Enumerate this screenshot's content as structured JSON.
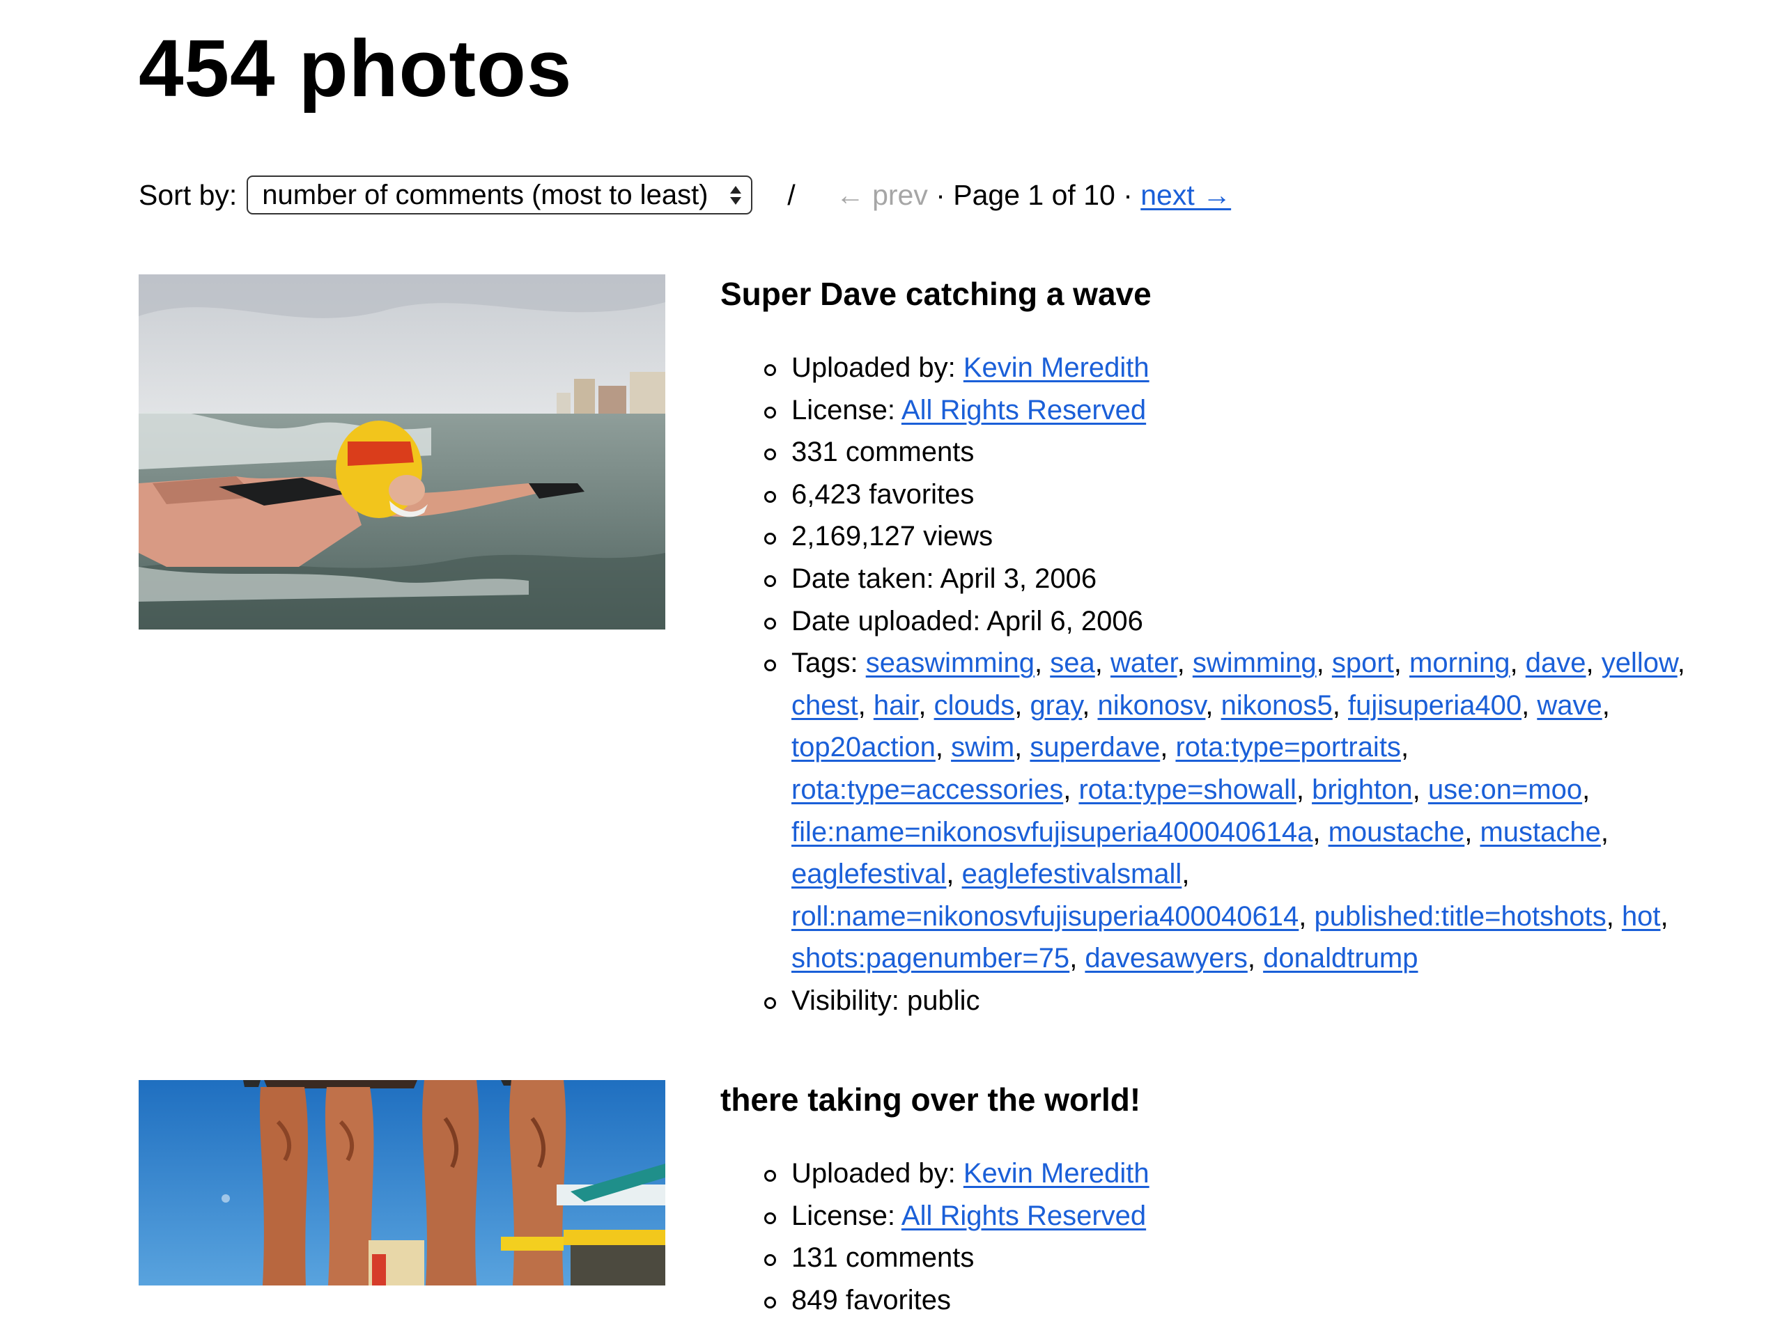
{
  "header": {
    "title": "454 photos"
  },
  "controls": {
    "sort_label": "Sort by:",
    "sort_selected": "number of comments (most to least)",
    "separator": "/",
    "prev_label": "← prev",
    "dot1": " · ",
    "page_label": "Page 1 of 10",
    "dot2": " · ",
    "next_label": "next →"
  },
  "colors": {
    "link": "#1a5fd8",
    "disabled": "#a6a6a6",
    "text": "#000000"
  },
  "photos": [
    {
      "title": "Super Dave catching a wave",
      "uploaded_by_label": "Uploaded by: ",
      "uploader": "Kevin Meredith",
      "license_label": "License: ",
      "license": "All Rights Reserved",
      "comments": "331 comments",
      "favorites": "6,423 favorites",
      "views": "2,169,127 views",
      "date_taken": "Date taken: April 3, 2006",
      "date_uploaded": "Date uploaded: April 6, 2006",
      "tags_label": "Tags: ",
      "tags": [
        "seaswimming",
        "sea",
        "water",
        "swimming",
        "sport",
        "morning",
        "dave",
        "yellow",
        "chest",
        "hair",
        "clouds",
        "gray",
        "nikonosv",
        "nikonos5",
        "fujisuperia400",
        "wave",
        "top20action",
        "swim",
        "superdave",
        "rota:type=portraits",
        "rota:type=accessories",
        "rota:type=showall",
        "brighton",
        "use:on=moo",
        "file:name=nikonosvfujisuperia400040614a",
        "moustache",
        "mustache",
        "eaglefestival",
        "eaglefestivalsmall",
        "roll:name=nikonosvfujisuperia400040614",
        "published:title=hotshots",
        "hot",
        "shots:pagenumber=75",
        "davesawyers",
        "donaldtrump"
      ],
      "visibility": "Visibility: public"
    },
    {
      "title": "there taking over the world!",
      "uploaded_by_label": "Uploaded by: ",
      "uploader": "Kevin Meredith",
      "license_label": "License: ",
      "license": "All Rights Reserved",
      "comments": "131 comments",
      "favorites": "849 favorites"
    }
  ]
}
